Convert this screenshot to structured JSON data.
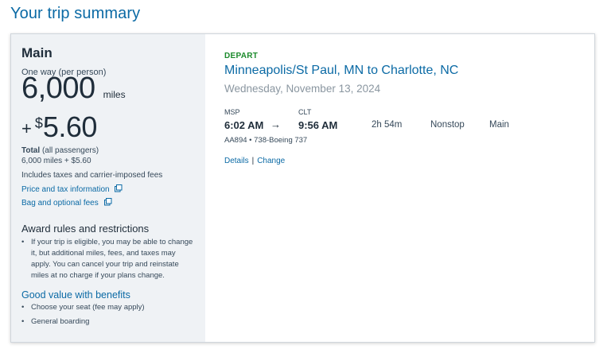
{
  "page": {
    "title": "Your trip summary"
  },
  "fare": {
    "cabin": "Main",
    "one_way_label": "One way (per person)",
    "miles": "6,000",
    "miles_unit": "miles",
    "plus": "+",
    "currency_symbol": "$",
    "cash": "5.60",
    "total_label": "Total",
    "total_suffix": "(all passengers)",
    "total_value": "6,000 miles + $5.60",
    "includes": "Includes taxes and carrier-imposed fees",
    "price_link": "Price and tax information",
    "bag_link": "Bag and optional fees"
  },
  "award": {
    "title": "Award rules and restrictions",
    "bullet": "•",
    "rule": "If your trip is eligible, you may be able to change it, but additional miles, fees, and taxes may apply. You can cancel your trip and reinstate miles at no charge if your plans change."
  },
  "benefits": {
    "title": "Good value with benefits",
    "items": [
      "Choose your seat (fee may apply)",
      "General boarding"
    ]
  },
  "flight": {
    "direction": "DEPART",
    "route": "Minneapolis/St Paul, MN to Charlotte, NC",
    "date": "Wednesday, November 13, 2024",
    "origin_code": "MSP",
    "dest_code": "CLT",
    "depart_time": "6:02 AM",
    "arrow": "→",
    "arrive_time": "9:56 AM",
    "duration": "2h 54m",
    "stops": "Nonstop",
    "cabin": "Main",
    "info": "AA894 • 738-Boeing 737",
    "details_link": "Details",
    "separator": "|",
    "change_link": "Change"
  },
  "icons": {
    "external": "external-link-icon",
    "arrow": "right-arrow-icon"
  },
  "colors": {
    "link": "#0b6aa5",
    "depart": "#1b8a2b",
    "panel": "#eff2f5"
  }
}
